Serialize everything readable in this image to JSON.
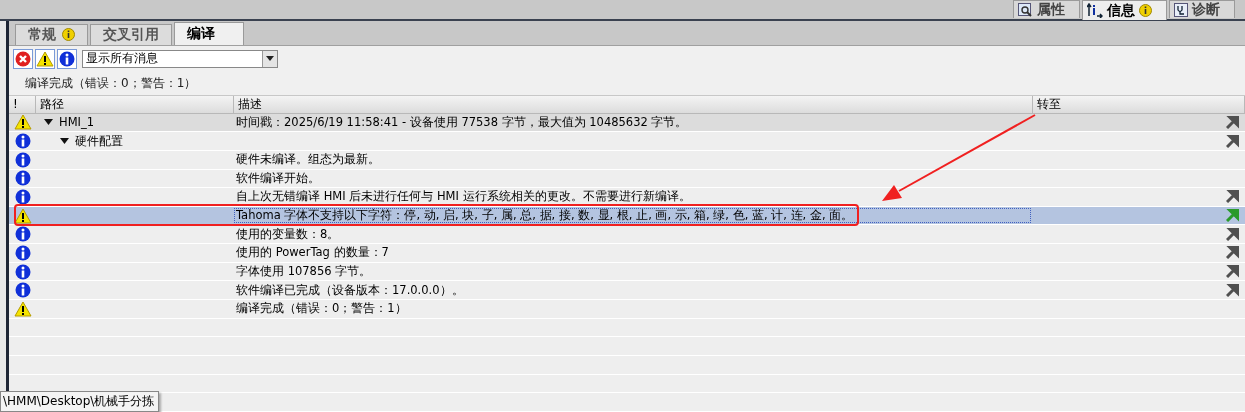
{
  "inspector_tabs": [
    {
      "label": "属性",
      "selected": false,
      "badge": false
    },
    {
      "label": "信息",
      "selected": true,
      "badge": true
    },
    {
      "label": "诊断",
      "selected": false,
      "badge": false
    }
  ],
  "tabs": [
    {
      "label": "常规",
      "selected": false,
      "badge": true
    },
    {
      "label": "交叉引用",
      "selected": false,
      "badge": false
    },
    {
      "label": "编译",
      "selected": true,
      "badge": false
    }
  ],
  "filters": [
    {
      "kind": "error",
      "on": true
    },
    {
      "kind": "warning",
      "on": true
    },
    {
      "kind": "info",
      "on": true
    }
  ],
  "message_filter": {
    "value": "显示所有消息"
  },
  "summary": "编译完成（错误：0；警告：1）",
  "table": {
    "columns": [
      "!",
      "路径",
      "描述",
      "转至"
    ],
    "rows": [
      {
        "kind": "warning",
        "path": "HMI_1",
        "expanded": true,
        "description": "时间戳：2025/6/19 11:58:41 - 设备使用 77538 字节，最大值为 10485632 字节。",
        "goto": true,
        "selected": false,
        "children": [
          {
            "kind": "info",
            "path": "硬件配置",
            "expanded": true,
            "goto": true,
            "selected": false,
            "children": [
              {
                "kind": "info",
                "description": "硬件未编译。组态为最新。",
                "goto": false,
                "selected": false
              },
              {
                "kind": "info",
                "description": "软件编译开始。",
                "goto": false,
                "selected": false
              },
              {
                "kind": "info",
                "description": "自上次无错编译 HMI 后未进行任何与 HMI 运行系统相关的更改。不需要进行新编译。",
                "goto": true,
                "selected": false
              },
              {
                "kind": "warning",
                "description": "Tahoma 字体不支持以下字符：停, 动, 启, 块, 子, 属, 总, 据, 接, 数, 显, 根, 止, 画, 示, 箱, 绿, 色, 蓝, 计, 连, 金, 面。",
                "goto": true,
                "selected": true
              },
              {
                "kind": "info",
                "description": "使用的变量数：8。",
                "goto": true,
                "selected": false
              },
              {
                "kind": "info",
                "description": "使用的 PowerTag 的数量：7",
                "goto": true,
                "selected": false
              },
              {
                "kind": "info",
                "description": "字体使用 107856 字节。",
                "goto": true,
                "selected": false
              },
              {
                "kind": "info",
                "description": "软件编译已完成（设备版本：17.0.0.0）。",
                "goto": true,
                "selected": false
              },
              {
                "kind": "warning",
                "description": "编译完成（错误：0；警告：1）",
                "goto": false,
                "selected": false
              }
            ]
          }
        ]
      }
    ]
  },
  "tooltip": "\\HMM\\Desktop\\机械手分拣"
}
